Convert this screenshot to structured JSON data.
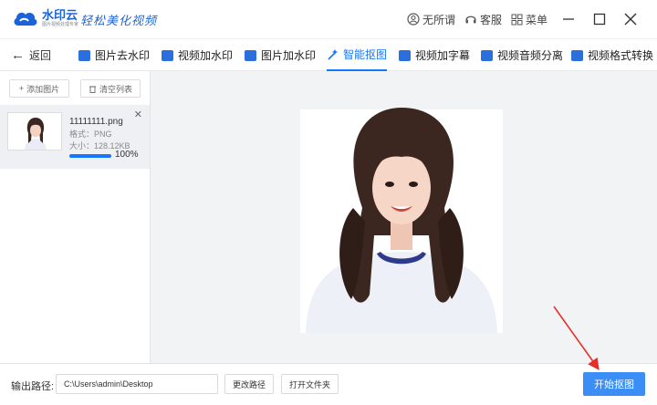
{
  "app": {
    "brand_name": "水印云",
    "brand_sub": "图片视频处理专家",
    "slogan": "轻松美化视频"
  },
  "titlebar": {
    "theme": "无所谓",
    "service": "客服",
    "menu": "菜单"
  },
  "nav": {
    "back": "返回",
    "tabs": [
      {
        "label": "图片去水印",
        "icon": "image-icon"
      },
      {
        "label": "视频加水印",
        "icon": "video-icon"
      },
      {
        "label": "图片加水印",
        "icon": "image-icon"
      },
      {
        "label": "智能抠图",
        "icon": "magic-wand-icon",
        "active": true
      },
      {
        "label": "视频加字幕",
        "icon": "subtitle-icon"
      },
      {
        "label": "视频音频分离",
        "icon": "split-icon"
      },
      {
        "label": "视频格式转换",
        "icon": "convert-icon"
      }
    ]
  },
  "left_panel": {
    "add_image": "添加图片",
    "clear_list": "清空列表",
    "files": [
      {
        "name": "11111111.png",
        "format": "格式：PNG",
        "size": "大小：128.12KB",
        "progress": 1.0,
        "progress_text": "100%"
      }
    ]
  },
  "bottom": {
    "output_label": "输出路径:",
    "output_path": "C:\\Users\\admin\\Desktop",
    "change_path": "更改路径",
    "open_folder": "打开文件夹",
    "start": "开始抠图"
  },
  "colors": {
    "accent": "#1677ff",
    "brand": "#1b63d8",
    "start_button": "#3a8ef6",
    "annotation_arrow": "#e5302a",
    "preview_bg": "#f2f3f5"
  }
}
